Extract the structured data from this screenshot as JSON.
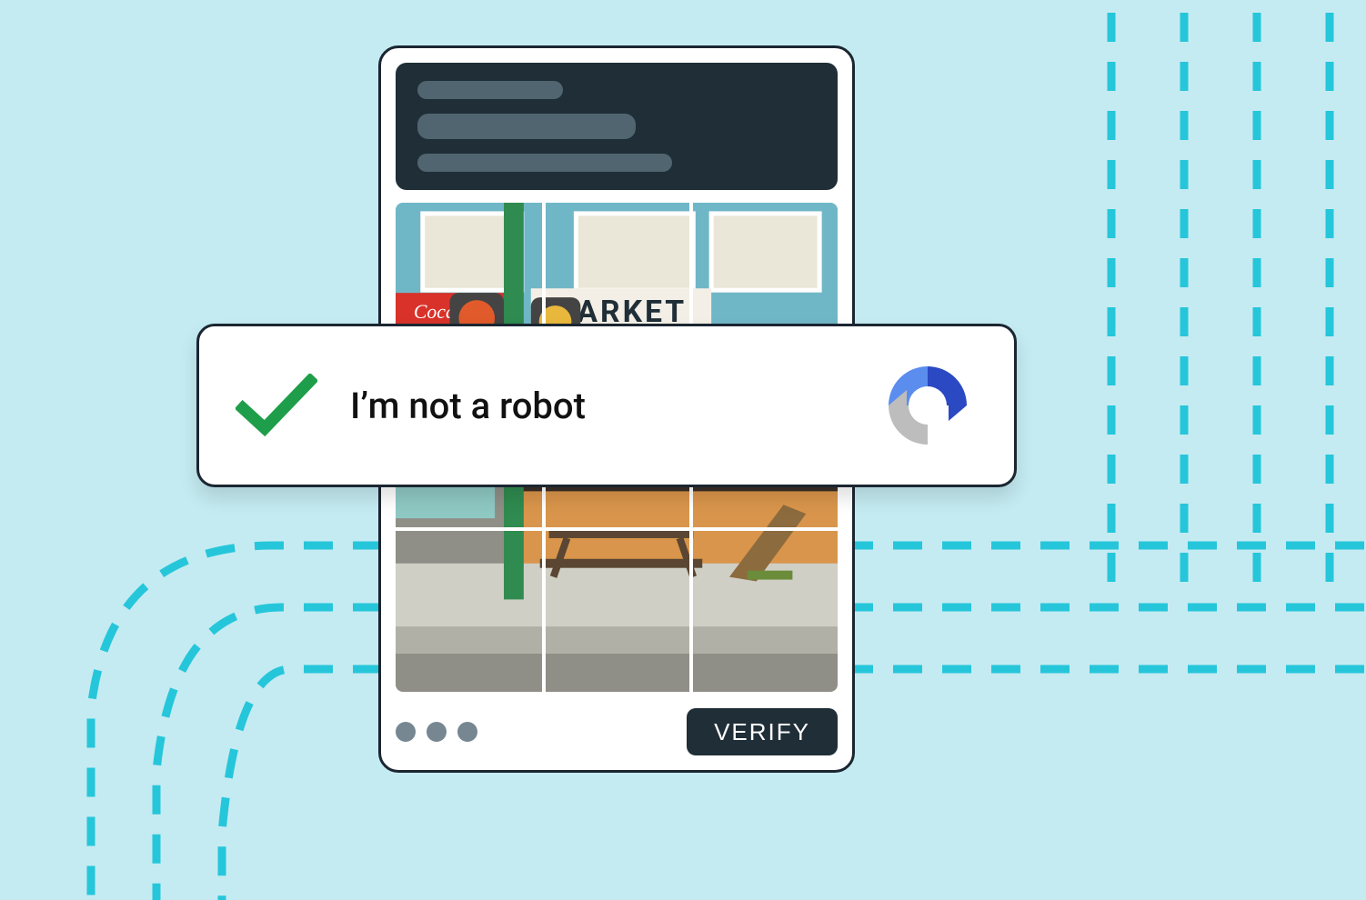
{
  "banner": {
    "label": "I’m not a robot"
  },
  "captcha": {
    "verify_label": "VERIFY",
    "grid": {
      "rows": 3,
      "cols": 3
    }
  },
  "icons": {
    "check": "check-icon",
    "recaptcha": "recaptcha-logo-icon"
  },
  "colors": {
    "background": "#C4EBF2",
    "dashed": "#26C6DA",
    "card_header": "#1F2E37",
    "button": "#1F2E37",
    "check": "#1E9E4A"
  }
}
